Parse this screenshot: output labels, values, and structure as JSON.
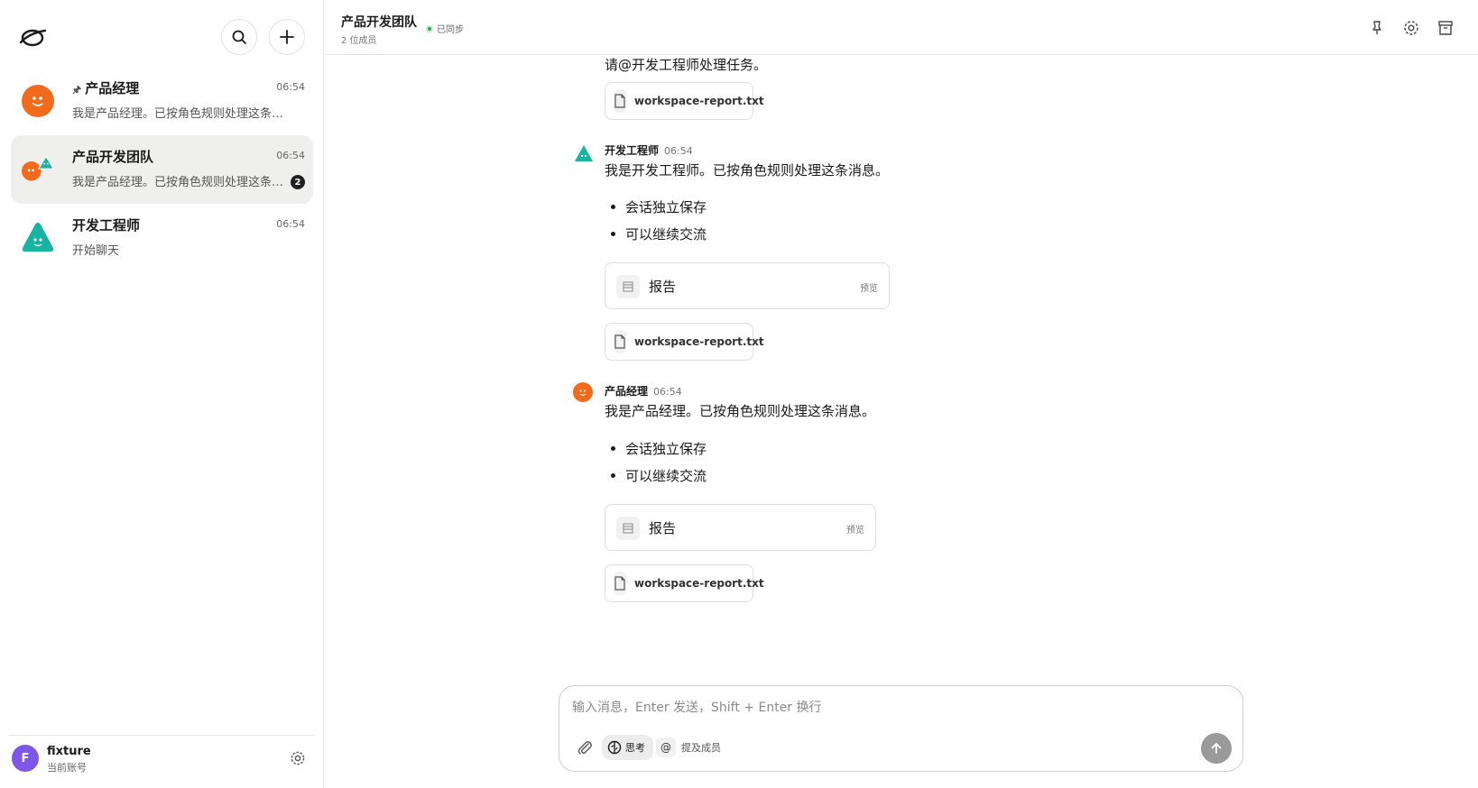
{
  "sidebar": {
    "conversations": [
      {
        "name": "产品经理",
        "time": "06:54",
        "preview": "我是产品经理。已按角色规则处理这条消息。",
        "pinned": true
      },
      {
        "name": "产品开发团队",
        "time": "06:54",
        "preview": "我是产品经理。已按角色规则处理这条消息。",
        "unread": "2",
        "active": true
      },
      {
        "name": "开发工程师",
        "time": "06:54",
        "preview": "开始聊天"
      }
    ],
    "account": {
      "initial": "F",
      "name": "fixture",
      "subtitle": "当前账号"
    }
  },
  "header": {
    "title": "产品开发团队",
    "members": "2 位成员",
    "sync_status": "已同步"
  },
  "messages": {
    "partial_text": "请@开发工程师处理任务。",
    "file_name": "workspace-report.txt",
    "engineer": {
      "sender": "开发工程师",
      "time": "06:54",
      "text": "我是开发工程师。已按角色规则处理这条消息。",
      "bullets": [
        "会话独立保存",
        "可以继续交流"
      ],
      "card_title": "报告",
      "card_preview": "预览"
    },
    "manager": {
      "sender": "产品经理",
      "time": "06:54",
      "text": "我是产品经理。已按角色规则处理这条消息。",
      "bullets": [
        "会话独立保存",
        "可以继续交流"
      ],
      "card_title": "报告",
      "card_preview": "预览"
    }
  },
  "composer": {
    "placeholder": "输入消息，Enter 发送，Shift + Enter 换行",
    "think_label": "思考",
    "mention_label": "提及成员"
  },
  "colors": {
    "manager_avatar": "#f26b1d",
    "engineer_avatar": "#17b3a3",
    "account_avatar": "#7e57e8"
  }
}
